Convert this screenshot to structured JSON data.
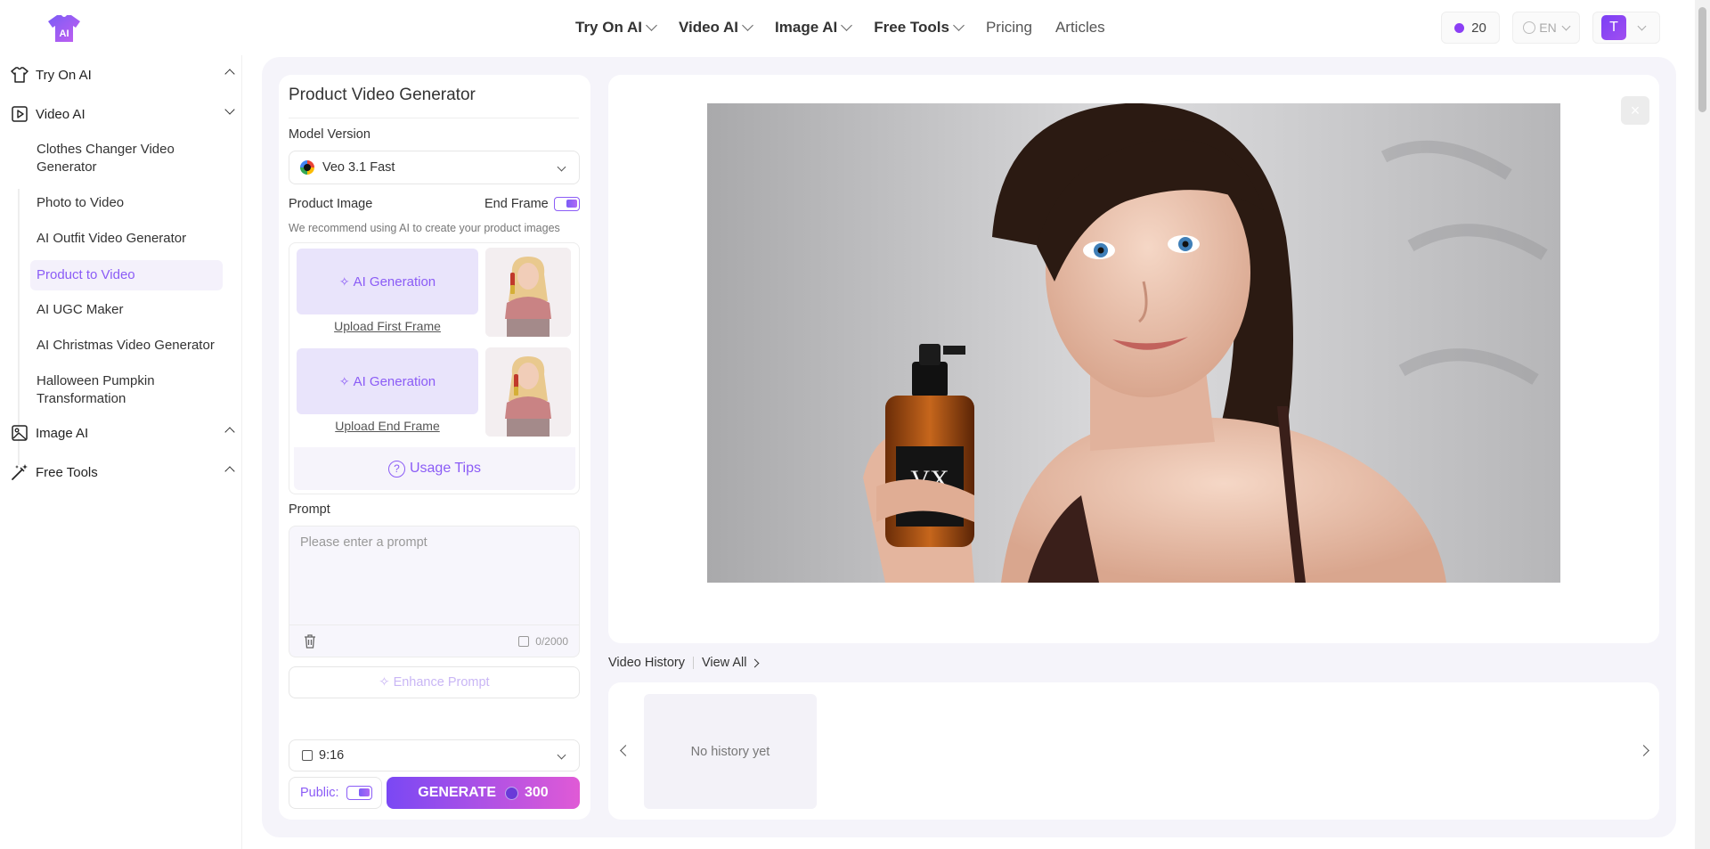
{
  "header": {
    "nav": [
      {
        "label": "Try On AI",
        "dropdown": true
      },
      {
        "label": "Video AI",
        "dropdown": true
      },
      {
        "label": "Image AI",
        "dropdown": true
      },
      {
        "label": "Free Tools",
        "dropdown": true
      },
      {
        "label": "Pricing",
        "dropdown": false
      },
      {
        "label": "Articles",
        "dropdown": false
      }
    ],
    "credits": "20",
    "language": "EN",
    "user_initial": "T"
  },
  "sidebar": {
    "groups": {
      "try_on": "Try On AI",
      "video": "Video AI",
      "image": "Image AI",
      "free_tools": "Free Tools"
    },
    "video_items": [
      "Clothes Changer Video Generator",
      "Photo to Video",
      "AI Outfit Video Generator",
      "Product to Video",
      "AI UGC Maker",
      "AI Christmas Video Generator",
      "Halloween Pumpkin Transformation"
    ],
    "active_item": "Product to Video"
  },
  "form": {
    "title": "Product Video Generator",
    "model_label": "Model Version",
    "model_value": "Veo 3.1 Fast",
    "product_image_label": "Product Image",
    "end_frame_label": "End Frame",
    "end_frame_on": true,
    "recommend": "We recommend using AI to create your product images",
    "ai_generation": "AI Generation",
    "upload_first": "Upload First Frame",
    "upload_end": "Upload End Frame",
    "usage_tips": "Usage Tips",
    "prompt_label": "Prompt",
    "prompt_placeholder": "Please enter a prompt",
    "prompt_counter": "0/2000",
    "enhance": "Enhance Prompt",
    "ratio": "9:16",
    "public_label": "Public:",
    "public_on": true,
    "generate": "GENERATE",
    "generate_cost": "300"
  },
  "preview": {
    "close": "×",
    "bottle_text": "VX"
  },
  "history": {
    "title": "Video History",
    "view_all": "View All",
    "empty": "No history yet"
  },
  "colors": {
    "accent": "#8b5cf6",
    "generate_start": "#7a48f4",
    "generate_end": "#e05ad6"
  }
}
